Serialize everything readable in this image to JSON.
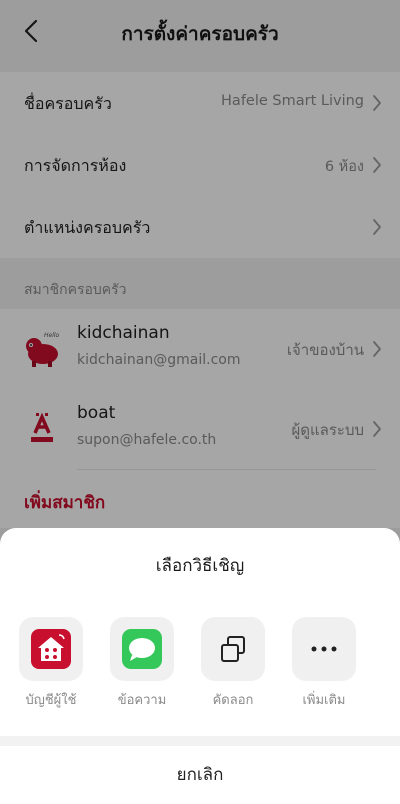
{
  "header": {
    "title": "การตั้งค่าครอบครัว",
    "back_icon": "chevron-left-icon"
  },
  "settings": {
    "family_name": {
      "label": "ชื่อครอบครัว",
      "value": "Hafele Smart Living"
    },
    "room_management": {
      "label": "การจัดการห้อง",
      "value": "6 ห้อง"
    },
    "family_location": {
      "label": "ตำแหน่งครอบครัว"
    }
  },
  "members_section": {
    "title": "สมาชิกครอบครัว",
    "members": [
      {
        "name": "kidchainan",
        "email": "kidchainan@gmail.com",
        "role": "เจ้าของบ้าน",
        "avatar": "cartoon-avatar-icon"
      },
      {
        "name": "boat",
        "email": "supon@hafele.co.th",
        "role": "ผู้ดูแลระบบ",
        "avatar": "hafele-logo-icon"
      }
    ],
    "add_member": "เพิ่มสมาชิก"
  },
  "invite_sheet": {
    "title": "เลือกวิธีเชิญ",
    "options": [
      {
        "label": "บัญชีผู้ใช้",
        "icon": "app-account-icon"
      },
      {
        "label": "ข้อความ",
        "icon": "message-icon"
      },
      {
        "label": "คัดลอก",
        "icon": "copy-icon"
      },
      {
        "label": "เพิ่มเติม",
        "icon": "more-icon"
      }
    ],
    "cancel": "ยกเลิก"
  },
  "colors": {
    "accent": "#c8102e",
    "message_green": "#34c759",
    "overlay": "rgba(0,0,0,0.35)"
  }
}
